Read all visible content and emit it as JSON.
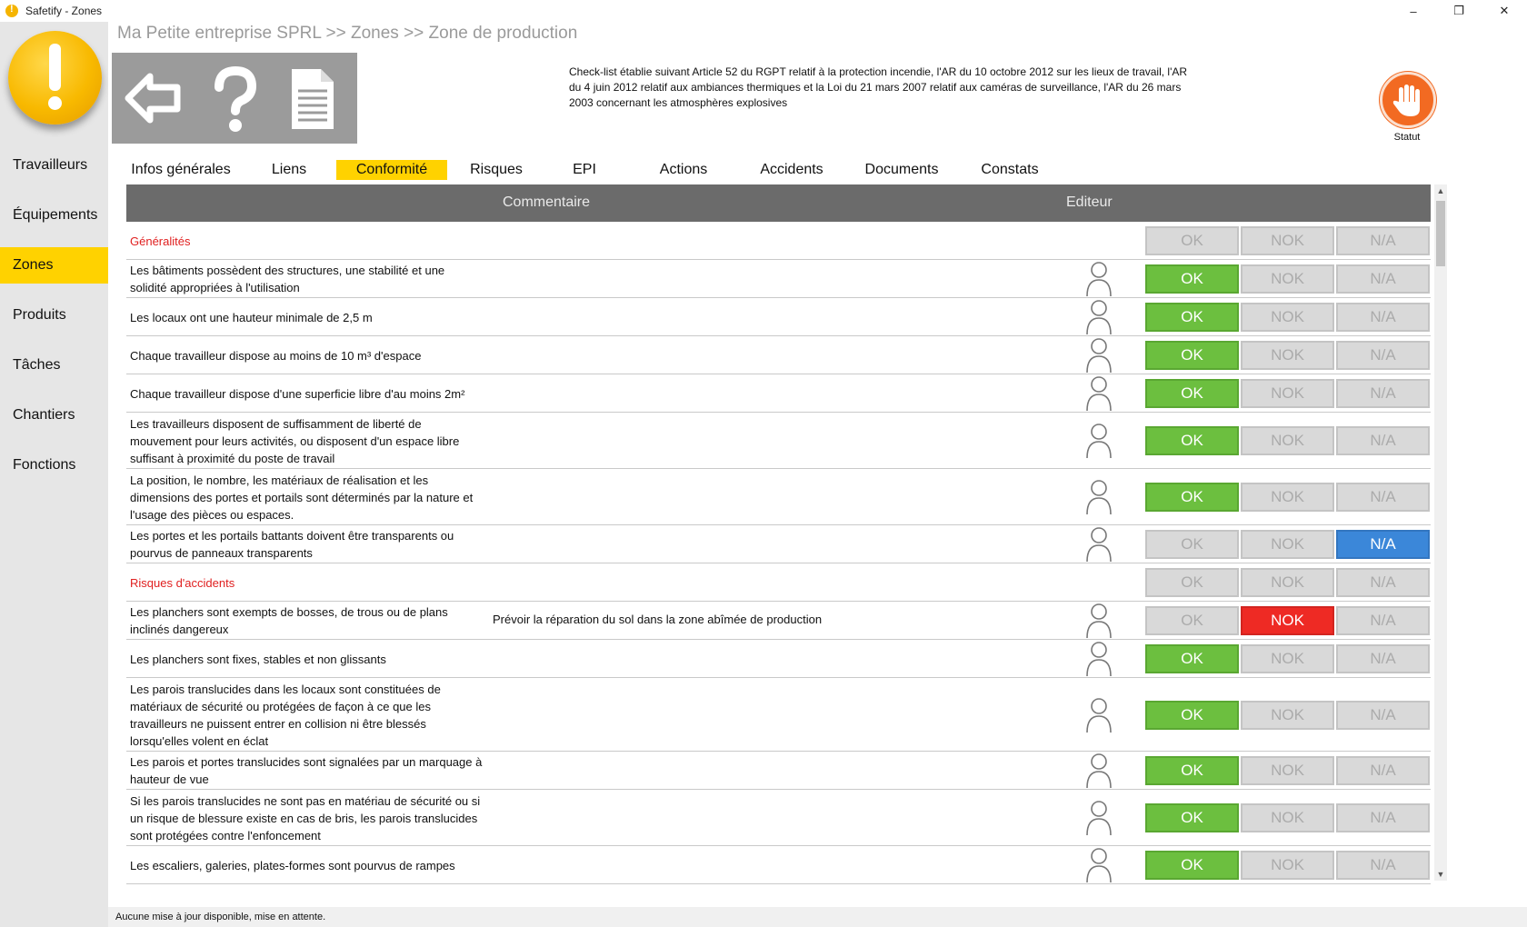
{
  "window": {
    "title": "Safetify - Zones",
    "controls": [
      "–",
      "❐",
      "✕"
    ]
  },
  "sidebar": {
    "items": [
      {
        "label": "Travailleurs",
        "active": false
      },
      {
        "label": "Équipements",
        "active": false
      },
      {
        "label": "Zones",
        "active": true
      },
      {
        "label": "Produits",
        "active": false
      },
      {
        "label": "Tâches",
        "active": false
      },
      {
        "label": "Chantiers",
        "active": false
      },
      {
        "label": "Fonctions",
        "active": false
      }
    ]
  },
  "header": {
    "breadcrumb": "Ma Petite entreprise SPRL >> Zones >> Zone de production",
    "notice": "Check-list établie suivant Article 52 du RGPT relatif à la protection incendie, l'AR du 10 octobre 2012 sur les lieux de travail, l'AR du 4 juin 2012 relatif aux ambiances thermiques et la Loi du 21 mars 2007 relatif aux caméras de surveillance, l'AR du 26 mars 2003 concernant les atmosphères explosives",
    "status_label": "Statut"
  },
  "tabs": [
    {
      "label": "Infos générales",
      "active": false
    },
    {
      "label": "Liens",
      "active": false
    },
    {
      "label": "Conformité",
      "active": true
    },
    {
      "label": "Risques",
      "active": false
    },
    {
      "label": "EPI",
      "active": false
    },
    {
      "label": "Actions",
      "active": false
    },
    {
      "label": "Accidents",
      "active": false
    },
    {
      "label": "Documents",
      "active": false
    },
    {
      "label": "Constats",
      "active": false
    }
  ],
  "table": {
    "col_comment": "Commentaire",
    "col_editor": "Editeur",
    "button_labels": {
      "ok": "OK",
      "nok": "NOK",
      "na": "N/A"
    },
    "rows": [
      {
        "type": "section",
        "text": "Généralités",
        "comment": "",
        "status": ""
      },
      {
        "type": "item",
        "text": "Les bâtiments possèdent des structures, une stabilité et une solidité appropriées à l'utilisation",
        "comment": "",
        "status": "ok"
      },
      {
        "type": "item",
        "text": "Les locaux ont une hauteur minimale de 2,5 m",
        "comment": "",
        "status": "ok"
      },
      {
        "type": "item",
        "text": "Chaque travailleur dispose au moins de 10 m³ d'espace",
        "comment": "",
        "status": "ok"
      },
      {
        "type": "item",
        "text": "Chaque travailleur dispose d'une superficie libre d'au moins 2m²",
        "comment": "",
        "status": "ok"
      },
      {
        "type": "item",
        "text": "Les travailleurs disposent de suffisamment de liberté de mouvement pour leurs activités, ou disposent d'un espace libre suffisant à proximité du poste de travail",
        "comment": "",
        "status": "ok"
      },
      {
        "type": "item",
        "text": "La position, le nombre, les matériaux de réalisation et les dimensions des portes et portails sont déterminés par la nature et l'usage des pièces ou espaces.",
        "comment": "",
        "status": "ok"
      },
      {
        "type": "item",
        "text": "Les portes et les portails battants doivent être transparents ou pourvus de panneaux transparents",
        "comment": "",
        "status": "na"
      },
      {
        "type": "section",
        "text": "Risques d'accidents",
        "comment": "",
        "status": ""
      },
      {
        "type": "item",
        "text": "Les planchers sont exempts de bosses, de trous ou de plans inclinés dangereux",
        "comment": "Prévoir la réparation du sol dans la zone abîmée de production",
        "status": "nok"
      },
      {
        "type": "item",
        "text": "Les planchers sont fixes, stables et non glissants",
        "comment": "",
        "status": "ok"
      },
      {
        "type": "item",
        "text": "Les parois translucides dans les locaux sont constituées de matériaux de sécurité ou protégées de façon à ce que les travailleurs ne puissent entrer en collision ni être blessés lorsqu'elles volent en éclat",
        "comment": "",
        "status": "ok"
      },
      {
        "type": "item",
        "text": "Les parois et portes translucides sont signalées par un marquage à hauteur de vue",
        "comment": "",
        "status": "ok"
      },
      {
        "type": "item",
        "text": "Si les parois translucides ne sont pas en matériau de sécurité ou si un risque de blessure existe en cas de bris, les parois translucides sont protégées contre l'enfoncement",
        "comment": "",
        "status": "ok"
      },
      {
        "type": "item",
        "text": "Les escaliers, galeries, plates-formes sont pourvus de rampes",
        "comment": "",
        "status": "ok"
      }
    ]
  },
  "statusbar": {
    "text": "Aucune mise à jour disponible, mise en attente."
  },
  "colors": {
    "accent": "#ffd200",
    "ok": "#6cbf3f",
    "nok": "#ee2a24",
    "na": "#3b87d9",
    "status": "#f26a22"
  }
}
